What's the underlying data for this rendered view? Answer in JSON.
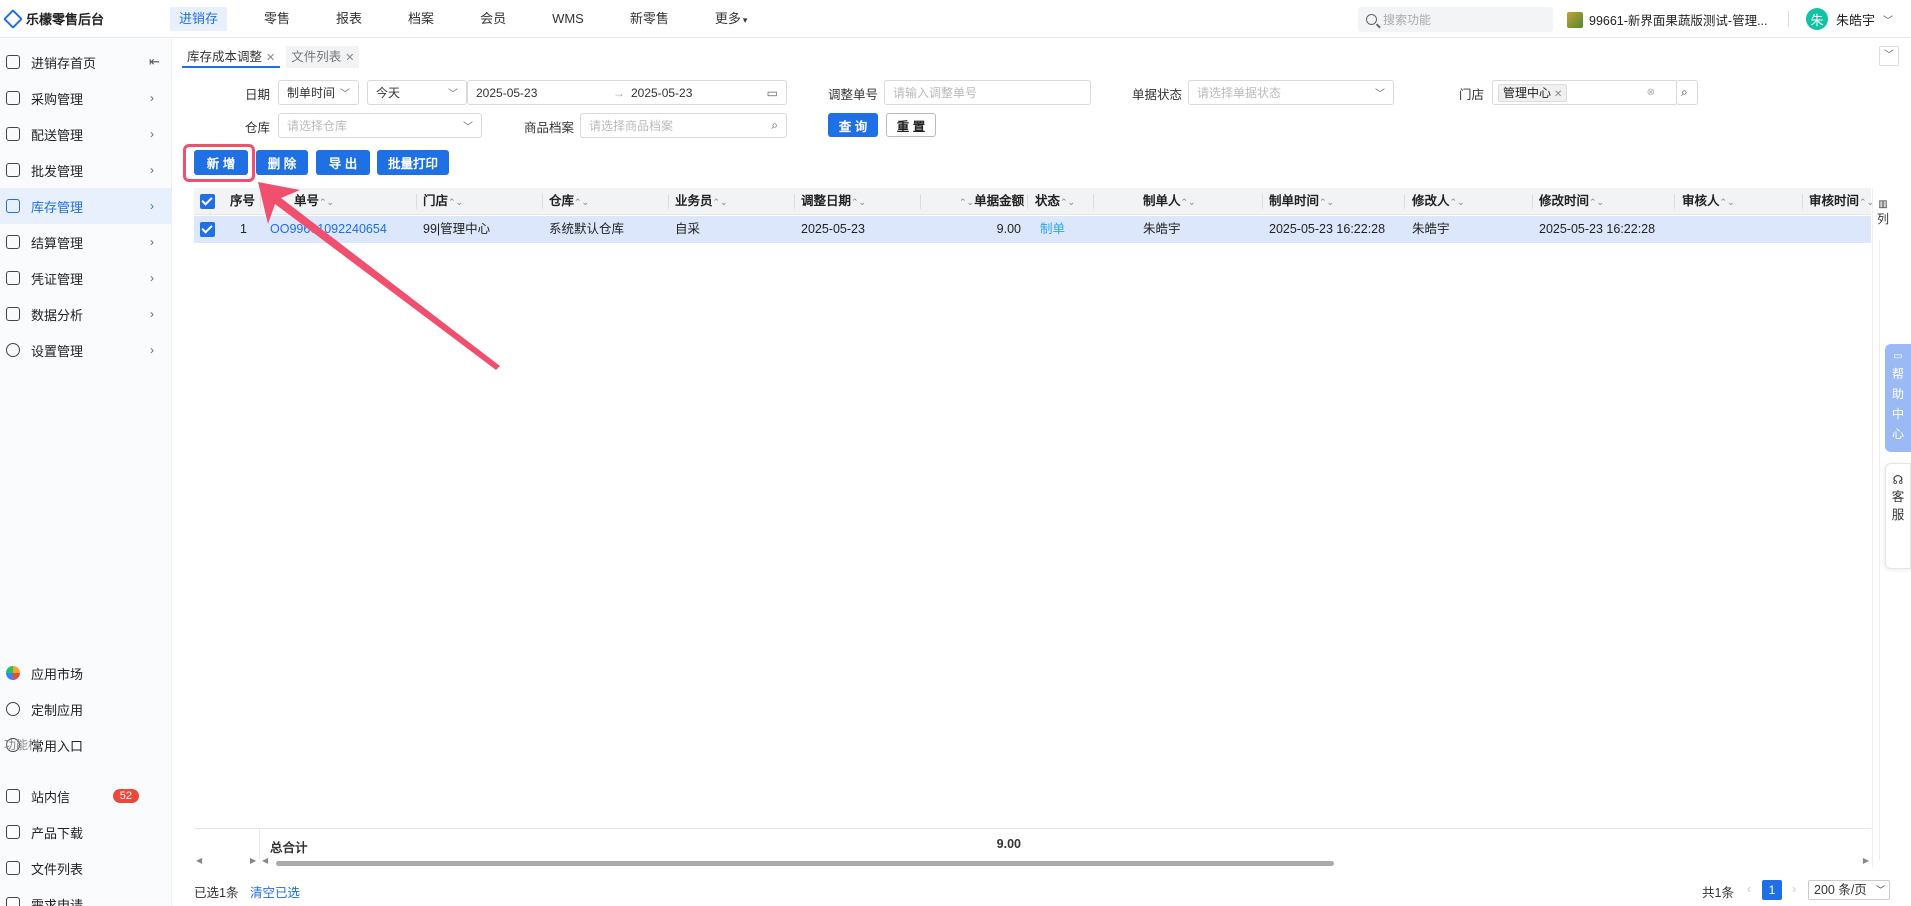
{
  "brand": {
    "title": "乐檬零售后台"
  },
  "topnav": [
    "进销存",
    "零售",
    "报表",
    "档案",
    "会员",
    "WMS",
    "新零售",
    "更多"
  ],
  "search": {
    "placeholder": "搜索功能"
  },
  "org": {
    "name": "99661-新界面果蔬版测试-管理..."
  },
  "user": {
    "avatar": "朱",
    "name": "朱皓宇"
  },
  "sidebar": {
    "items": [
      {
        "label": "进销存首页"
      },
      {
        "label": "采购管理"
      },
      {
        "label": "配送管理"
      },
      {
        "label": "批发管理"
      },
      {
        "label": "库存管理"
      },
      {
        "label": "结算管理"
      },
      {
        "label": "凭证管理"
      },
      {
        "label": "数据分析"
      },
      {
        "label": "设置管理"
      }
    ],
    "bottom": [
      {
        "label": "应用市场"
      },
      {
        "label": "定制应用"
      },
      {
        "label": "常用入口"
      }
    ],
    "section": "功能栏",
    "func": [
      {
        "label": "站内信",
        "badge": "52"
      },
      {
        "label": "产品下载"
      },
      {
        "label": "文件列表"
      },
      {
        "label": "需求申请"
      }
    ]
  },
  "tabs": [
    {
      "label": "库存成本调整"
    },
    {
      "label": "文件列表"
    }
  ],
  "filters": {
    "date_label": "日期",
    "date_type": "制单时间",
    "date_range": "今天",
    "date_start": "2025-05-23",
    "date_end": "2025-05-23",
    "order_no_label": "调整单号",
    "order_no_placeholder": "请输入调整单号",
    "status_label": "单据状态",
    "status_placeholder": "请选择单据状态",
    "store_label": "门店",
    "store_tag": "管理中心",
    "warehouse_label": "仓库",
    "warehouse_placeholder": "请选择仓库",
    "product_label": "商品档案",
    "product_placeholder": "请选择商品档案",
    "query_btn": "查 询",
    "reset_btn": "重 置"
  },
  "actions": {
    "add": "新 增",
    "delete": "删 除",
    "export": "导 出",
    "batch_print": "批量打印"
  },
  "table": {
    "headers": [
      "序号",
      "单号",
      "门店",
      "仓库",
      "业务员",
      "调整日期",
      "单据金额",
      "状态",
      "制单人",
      "制单时间",
      "修改人",
      "修改时间",
      "审核人",
      "审核时间"
    ],
    "rows": [
      [
        "1",
        "OO99661092240654",
        "99|管理中心",
        "系统默认仓库",
        "自采",
        "2025-05-23",
        "9.00",
        "制单",
        "朱皓宇",
        "2025-05-23 16:22:28",
        "朱皓宇",
        "2025-05-23 16:22:28",
        "",
        ""
      ]
    ],
    "total_label": "总合计",
    "total_amount": "9.00",
    "col_btn": "列"
  },
  "help": {
    "text": "帮助中心"
  },
  "kefu": {
    "text": "客服"
  },
  "footer": {
    "selected": "已选1条",
    "clear": "清空已选",
    "count": "共1条",
    "page": "1",
    "page_size": "200 条/页"
  }
}
